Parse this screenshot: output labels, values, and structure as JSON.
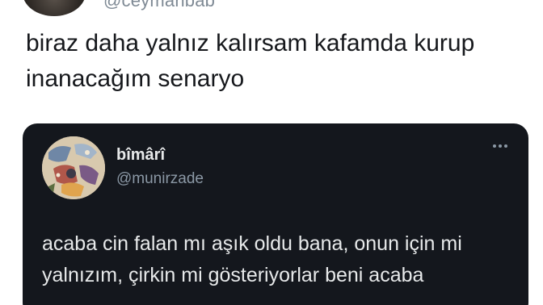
{
  "author": {
    "handle": "@ceymanbab"
  },
  "tweet": {
    "text": "biraz daha yalnız kalırsam kafamda kurup inanacağım senaryo"
  },
  "quoted_tweet": {
    "display_name": "bîmârî",
    "handle": "@munirzade",
    "text": "acaba cin falan mı aşık oldu bana, onun için mi yalnızım, çirkin mi gösteriyorlar beni acaba",
    "more_icon": "more-horizontal-icon"
  },
  "colors": {
    "background": "#ffffff",
    "text": "#16181c",
    "card_background": "#14171d",
    "card_text": "#e7e9ea",
    "secondary_text": "#8b98a5"
  }
}
